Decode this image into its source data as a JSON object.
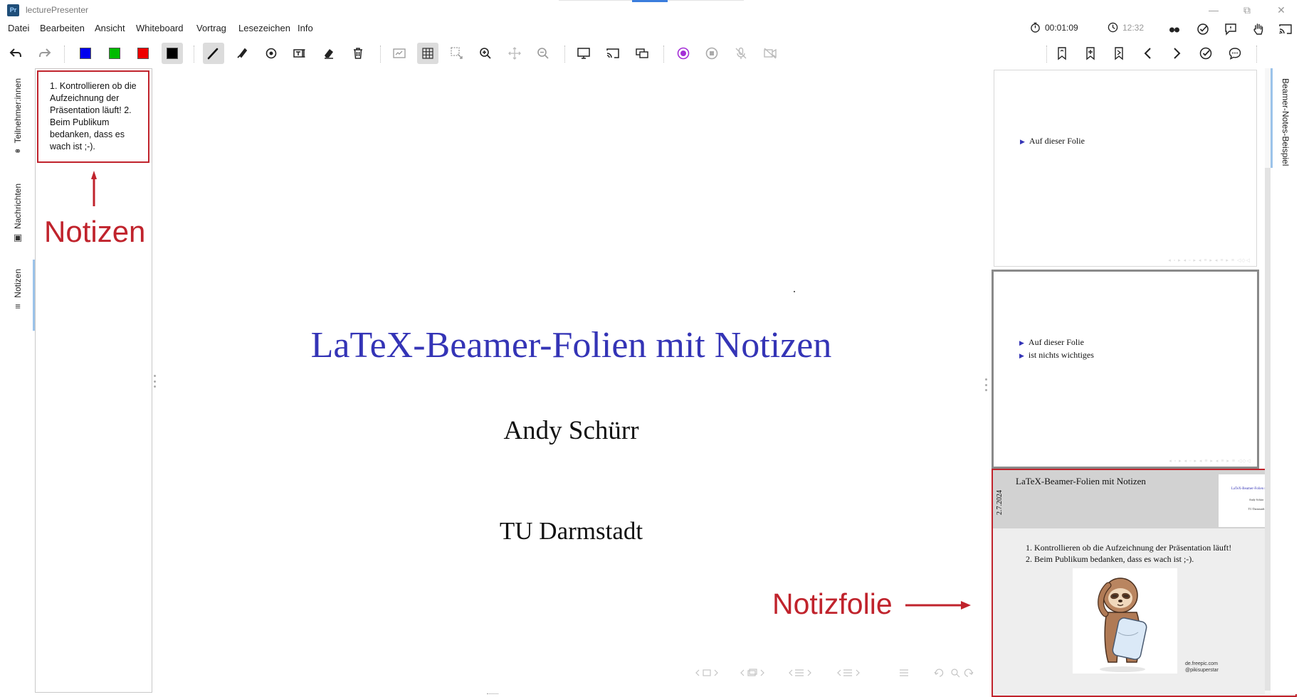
{
  "window": {
    "app_icon": "Pr",
    "title": "lecturePresenter"
  },
  "menu": {
    "items": [
      "Datei",
      "Bearbeiten",
      "Ansicht",
      "Whiteboard",
      "Vortrag",
      "Lesezeichen",
      "Info"
    ],
    "timer": "00:01:09",
    "clock": "12:32"
  },
  "colors": {
    "accent_red": "#c0232c",
    "slide_title_blue": "#3434b6",
    "record_purple": "#a42fd6",
    "pen_blue": "#0000ee",
    "pen_green": "#00bb00",
    "pen_red": "#ee0000",
    "pen_black": "#000000"
  },
  "left_tabs": {
    "participants": "Teilnehmer:innen",
    "messages": "Nachrichten",
    "notes": "Notizen"
  },
  "notes_panel": {
    "text": "1. Kontrollieren ob die Aufzeichnung der Präsentation läuft! 2. Beim Publikum bedanken, dass es wach ist ;-).",
    "annotation": "Notizen"
  },
  "slide": {
    "title": "LaTeX-Beamer-Folien mit Notizen",
    "author": "Andy Schürr",
    "institute": "TU Darmstadt",
    "annotation": "Notizfolie"
  },
  "previews": {
    "slide1_bullets": [
      "Auf dieser Folie"
    ],
    "slide2_bullets": [
      "Auf dieser Folie",
      "ist nichts wichtiges"
    ],
    "note_slide": {
      "title": "LaTeX-Beamer-Folien mit Notizen",
      "date": "2.7.2024",
      "mini_title": "LaTeX-Beamer-Folien mit Notizen",
      "mini_author": "Andy Schürr",
      "mini_institute": "TU Darmstadt",
      "items": [
        "Kontrollieren ob die Aufzeichnung der Präsentation läuft!",
        "Beim Publikum bedanken, dass es wach ist ;-)."
      ],
      "credit_line1": "de.freepic.com",
      "credit_line2": "@pikisuperstar"
    }
  },
  "right_sidebar": {
    "label": "Beamer-Notes-Beispiel"
  }
}
